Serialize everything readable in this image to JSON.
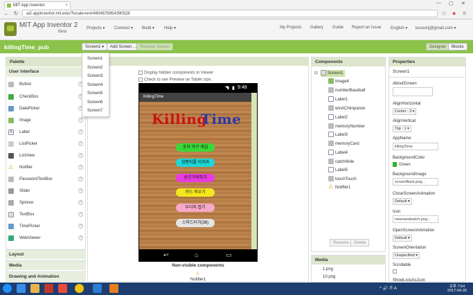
{
  "browser": {
    "tab_title": "MIT App Inventor",
    "url": "ai2.appinventor.mit.edu/?locale=en#4604676954390528"
  },
  "header": {
    "app_title": "MIT App Inventor 2",
    "app_subtitle": "Beta",
    "menus": [
      "Projects",
      "Connect",
      "Build",
      "Help"
    ],
    "right_menus": [
      "My Projects",
      "Gallery",
      "Guide",
      "Report an Issue",
      "English",
      "kussonj@gmail.com"
    ]
  },
  "toolbar": {
    "project_name": "killingTime_pub",
    "screen_select": "Screen1 ▾",
    "add_screen": "Add Screen ...",
    "remove_screen": "Remove Screen",
    "designer": "Designer",
    "blocks": "Blocks"
  },
  "screen_dropdown": [
    "Screen1",
    "Screen2",
    "Screen3",
    "Screen4",
    "Screen5",
    "Screen6",
    "Screen7"
  ],
  "palette": {
    "title": "Palette",
    "category": "User Interface",
    "items": [
      "Button",
      "CheckBox",
      "DatePicker",
      "Image",
      "Label",
      "ListPicker",
      "ListView",
      "Notifier",
      "PasswordTextBox",
      "Slider",
      "Spinner",
      "TextBox",
      "TimePicker",
      "WebViewer"
    ],
    "sections": [
      "Layout",
      "Media",
      "Drawing and Animation"
    ]
  },
  "viewer": {
    "check_hidden": "Display hidden components in Viewer",
    "check_tablet": "Check to see Preview on Tablet size.",
    "time": "9:48",
    "screen_title": "KillingTime",
    "logo_word1": "Killing",
    "logo_word2": "Time",
    "buttons": [
      {
        "label": "숫자 야구 게임",
        "color": "#39d839"
      },
      {
        "label": "침팬지를 이겨라",
        "color": "#1fd6d6"
      },
      {
        "label": "순간기억하기",
        "color": "#e83be0"
      },
      {
        "label": "카드 외우기",
        "color": "#f5e71e"
      },
      {
        "label": "두더지 잡기",
        "color": "#f7a8c8"
      },
      {
        "label": "스피드터치(36)",
        "color": "#e4e4e4"
      }
    ],
    "nonvisible_title": "Non-visible components",
    "notifier": "Notifier1"
  },
  "components": {
    "title": "Components",
    "root": "Screen1",
    "items": [
      "Image4",
      "numberBaseball",
      "Label1",
      "winAChimpanze",
      "Label2",
      "memoryNumber",
      "Label3",
      "memoryCard",
      "Label4",
      "catchMole",
      "Label5",
      "touchTouch",
      "Notifier1"
    ],
    "rename": "Rename",
    "delete": "Delete"
  },
  "media": {
    "title": "Media",
    "files": [
      "1.png",
      "10.png"
    ]
  },
  "properties": {
    "title": "Properties",
    "component": "Screen1",
    "about_label": "AboutScreen",
    "align_h_label": "AlignHorizontal",
    "align_h_value": "Center : 3 ▾",
    "align_v_label": "AlignVertical",
    "align_v_value": "Top : 1 ▾",
    "appname_label": "AppName",
    "appname_value": "killingTime",
    "bgcolor_label": "BackgroundColor",
    "bgcolor_value": "Green",
    "bgimage_label": "BackgroundImage",
    "bgimage_value": "screenBack.png...",
    "close_anim_label": "CloseScreenAnimation",
    "close_anim_value": "Default ▾",
    "icon_label": "Icon",
    "icon_value": "newsandwatch.png...",
    "open_anim_label": "OpenScreenAnimation",
    "open_anim_value": "Default ▾",
    "orientation_label": "ScreenOrientation",
    "orientation_value": "Unspecified ▾",
    "scrollable_label": "Scrollable",
    "showlists_label": "ShowListsAsJson"
  },
  "taskbar": {
    "tray": "^ 🔊 가 A",
    "time": "오후 7:54",
    "date": "2017-04-20"
  }
}
